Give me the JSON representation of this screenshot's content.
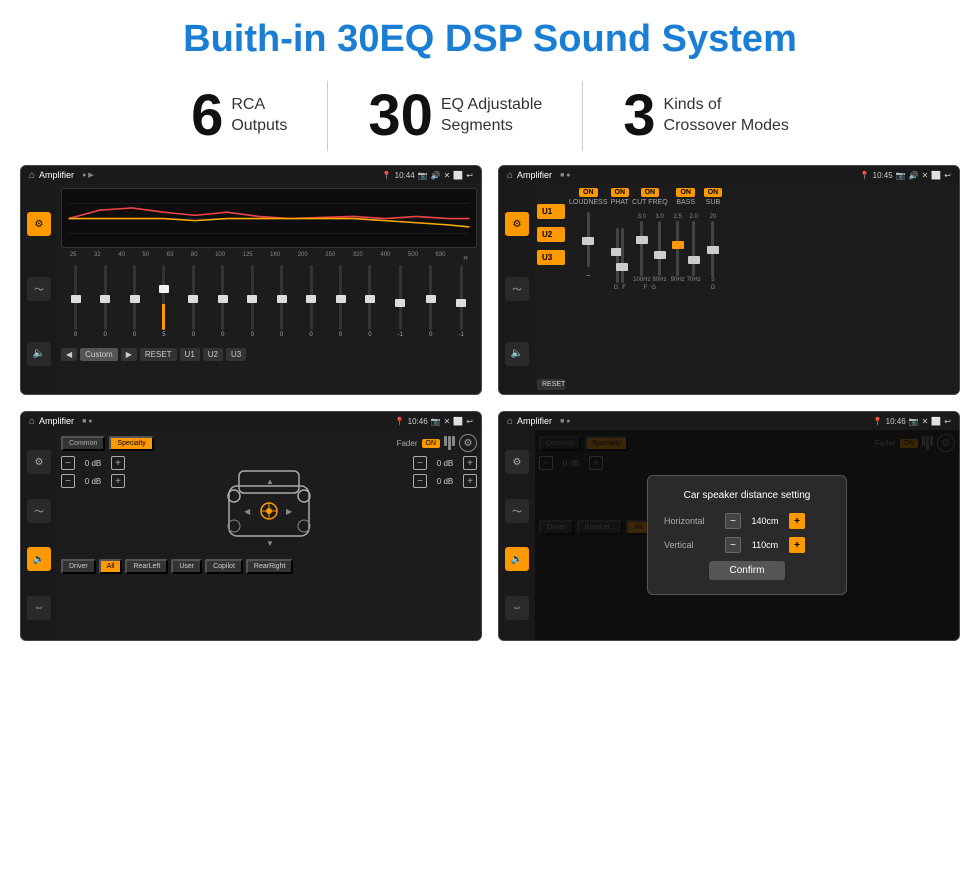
{
  "header": {
    "title": "Buith-in 30EQ DSP Sound System"
  },
  "stats": [
    {
      "number": "6",
      "label_line1": "RCA",
      "label_line2": "Outputs"
    },
    {
      "number": "30",
      "label_line1": "EQ Adjustable",
      "label_line2": "Segments"
    },
    {
      "number": "3",
      "label_line1": "Kinds of",
      "label_line2": "Crossover Modes"
    }
  ],
  "screens": [
    {
      "id": "screen1",
      "statusbar": {
        "app": "Amplifier",
        "time": "10:44",
        "icons": "📷 🔊 ✕ ⬜ ↩"
      },
      "type": "eq",
      "bottom_buttons": [
        "◀",
        "Custom",
        "▶",
        "RESET",
        "U1",
        "U2",
        "U3"
      ],
      "freq_labels": [
        "25",
        "32",
        "40",
        "50",
        "63",
        "80",
        "100",
        "125",
        "160",
        "200",
        "250",
        "320",
        "400",
        "500",
        "630"
      ],
      "slider_values": [
        "0",
        "0",
        "0",
        "5",
        "0",
        "0",
        "0",
        "0",
        "0",
        "0",
        "0",
        "-1",
        "0",
        "-1"
      ]
    },
    {
      "id": "screen2",
      "statusbar": {
        "app": "Amplifier",
        "time": "10:45"
      },
      "type": "crossover",
      "u_labels": [
        "U1",
        "U2",
        "U3"
      ],
      "sections": [
        {
          "toggle": "ON",
          "label": "LOUDNESS"
        },
        {
          "toggle": "ON",
          "label": "PHAT"
        },
        {
          "toggle": "ON",
          "label": "CUT FREQ"
        },
        {
          "toggle": "ON",
          "label": "BASS"
        },
        {
          "toggle": "ON",
          "label": "SUB"
        }
      ],
      "reset_btn": "RESET"
    },
    {
      "id": "screen3",
      "statusbar": {
        "app": "Amplifier",
        "time": "10:46"
      },
      "type": "fader",
      "tabs": [
        "Common",
        "Specialty"
      ],
      "active_tab": "Specialty",
      "fader_label": "Fader",
      "fader_on": "ON",
      "db_values": [
        "0 dB",
        "0 dB",
        "0 dB",
        "0 dB"
      ],
      "bottom_buttons": [
        "Driver",
        "RearLeft",
        "All",
        "User",
        "Copilot",
        "RearRight"
      ]
    },
    {
      "id": "screen4",
      "statusbar": {
        "app": "Amplifier",
        "time": "10:46"
      },
      "type": "fader_dialog",
      "tabs": [
        "Common",
        "Specialty"
      ],
      "active_tab": "Specialty",
      "dialog": {
        "title": "Car speaker distance setting",
        "horizontal_label": "Horizontal",
        "horizontal_value": "140cm",
        "vertical_label": "Vertical",
        "vertical_value": "110cm",
        "confirm_label": "Confirm"
      },
      "db_values": [
        "0 dB",
        "0 dB"
      ],
      "bottom_buttons": [
        "Driver",
        "RearLef...",
        "All",
        "User",
        "Copilot",
        "RearRight"
      ]
    }
  ]
}
